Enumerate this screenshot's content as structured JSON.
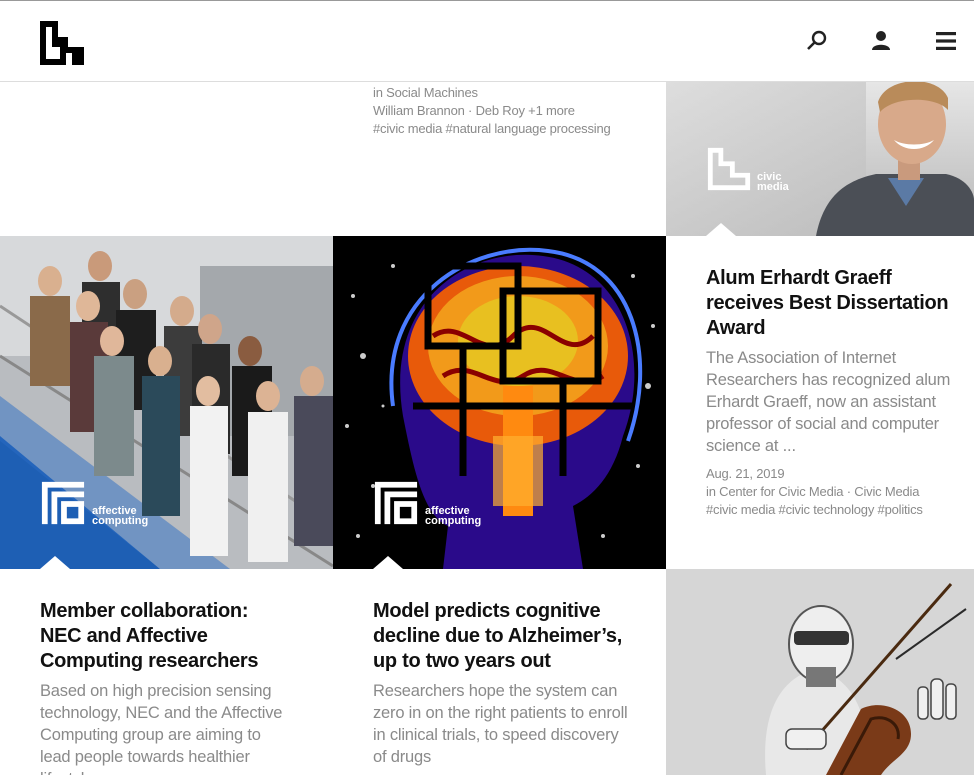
{
  "header": {
    "logo_icon": "media-lab-logo",
    "search_icon": "search-icon",
    "account_icon": "user-icon",
    "menu_icon": "menu-icon"
  },
  "top_article": {
    "group_line": "in Social Machines",
    "authors": "William Brannon · Deb Roy +1 more",
    "tags": "#civic media #natural language processing"
  },
  "top_image": {
    "group_label_1": "civic",
    "group_label_2": "media"
  },
  "graeff_article": {
    "title": "Alum Erhardt Graeff receives Best Dissertation Award",
    "description": "The Association of Internet Researchers has recognized alum Erhardt Graeff, now an assistant professor of social and computer science at ...",
    "date": "Aug. 21, 2019",
    "group_line": "in Center for Civic Media · Civic Media",
    "tags": "#civic media #civic technology #politics"
  },
  "nec_article": {
    "group_label_1": "affective",
    "group_label_2": "computing",
    "title": "Member collaboration: NEC and Affective Computing researchers",
    "description": "Based on high precision sensing technology, NEC and the Affective Computing group are aiming to lead people towards healthier lifestyles"
  },
  "alzheimers_article": {
    "group_label_1": "affective",
    "group_label_2": "computing",
    "title": "Model predicts cognitive decline due to Alzheimer’s, up to two years out",
    "description": "Researchers hope the system can zero in on the right patients to enroll in clinical trials, to speed discovery of drugs"
  },
  "colors": {
    "accent_blue": "#1e5fb4",
    "text_dark": "#111111",
    "text_gray": "#8a8a8a"
  }
}
